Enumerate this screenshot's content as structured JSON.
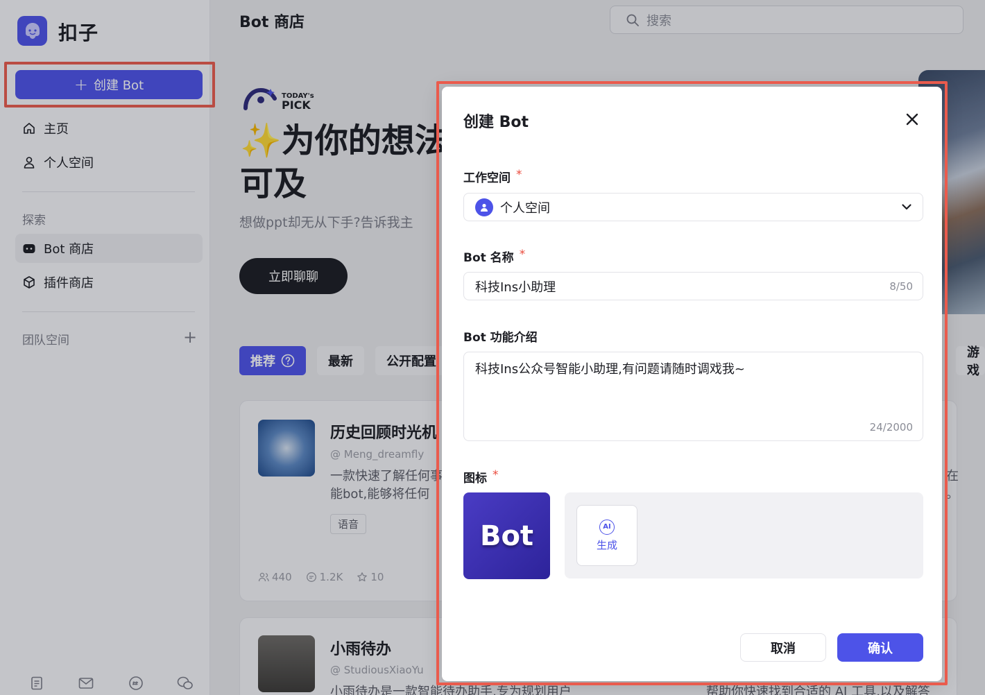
{
  "app": {
    "name": "扣子"
  },
  "sidebar": {
    "create_label": "创建 Bot",
    "home": "主页",
    "personal": "个人空间",
    "explore_label": "探索",
    "bot_store": "Bot 商店",
    "plugin_store": "插件商店",
    "team_label": "团队空间"
  },
  "header": {
    "title": "Bot 商店",
    "search_placeholder": "搜索"
  },
  "hero": {
    "badge_top": "TODAY's",
    "badge_bottom": "PICK",
    "title_line1": "✨为你的想法",
    "title_line2": "可及",
    "subtitle": "想做ppt却无从下手?告诉我主",
    "cta": "立即聊聊"
  },
  "tabs": [
    {
      "label": "推荐"
    },
    {
      "label": "最新"
    },
    {
      "label": "公开配置"
    },
    {
      "label": "游戏"
    }
  ],
  "cards": [
    {
      "title": "历史回顾时光机",
      "author": "Meng_dreamfly",
      "desc_line1": "一款快速了解任何事",
      "desc_line2": "能bot,能够将任何",
      "tag": "语音",
      "users": "440",
      "chats": "1.2K",
      "stars": "10",
      "right_fragment_1": "在",
      "right_fragment_2": "。"
    },
    {
      "title": "小雨待办",
      "author": "StudiousXiaoYu",
      "desc_line1": "小雨待办是一款智能待办助手,专为规划用户",
      "right_desc": "帮助你快速找到合适的 AI 工具,以及解答"
    }
  ],
  "modal": {
    "title": "创建 Bot",
    "workspace_label": "工作空间",
    "workspace_value": "个人空间",
    "name_label": "Bot 名称",
    "name_value": "科技Ins小助理",
    "name_count": "8/50",
    "desc_label": "Bot 功能介绍",
    "desc_value": "科技Ins公众号智能小助理,有问题请随时调戏我~",
    "desc_count": "24/2000",
    "icon_label": "图标",
    "icon_text": "Bot",
    "ai_badge": "AI",
    "ai_generate": "生成",
    "required_mark": "*",
    "cancel": "取消",
    "confirm": "确认"
  },
  "colors": {
    "brand": "#4d53e8",
    "highlight": "#ea5b4d",
    "dark": "#1c1d23"
  }
}
